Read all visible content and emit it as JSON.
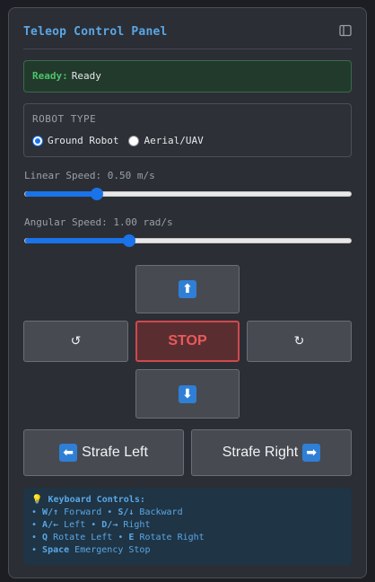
{
  "header": {
    "title": "Teleop Control Panel",
    "collapse_icon": "sidebar-collapse-icon"
  },
  "status": {
    "label": "Ready:",
    "value": "Ready"
  },
  "robot_type": {
    "legend": "ROBOT TYPE",
    "options": [
      {
        "label": "Ground Robot",
        "checked": true
      },
      {
        "label": "Aerial/UAV",
        "checked": false
      }
    ]
  },
  "linear": {
    "label": "Linear Speed: 0.50 m/s",
    "fraction": 0.22
  },
  "angular": {
    "label": "Angular Speed: 1.00 rad/s",
    "fraction": 0.32
  },
  "controls": {
    "forward_icon": "⬆",
    "backward_icon": "⬇",
    "rotate_left_icon": "↺",
    "rotate_right_icon": "↻",
    "stop_label": "STOP",
    "strafe_left_icon": "⬅",
    "strafe_left_label": "Strafe Left",
    "strafe_right_label": "Strafe Right",
    "strafe_right_icon": "➡"
  },
  "keyboard": {
    "bulb": "💡",
    "title": "Keyboard Controls:",
    "lines": [
      [
        {
          "k": "W/↑",
          "t": " Forward • "
        },
        {
          "k": "S/↓",
          "t": " Backward"
        }
      ],
      [
        {
          "k": "A/←",
          "t": " Left • "
        },
        {
          "k": "D/→",
          "t": " Right"
        }
      ],
      [
        {
          "k": "Q",
          "t": " Rotate Left • "
        },
        {
          "k": "E",
          "t": " Rotate Right"
        }
      ],
      [
        {
          "k": "Space",
          "t": " Emergency Stop"
        }
      ]
    ],
    "bullet": "•"
  },
  "colors": {
    "accent": "#5aa7e6",
    "slider": "#1a73e8",
    "stop": "#d0484c",
    "ready": "#4cc46a"
  }
}
